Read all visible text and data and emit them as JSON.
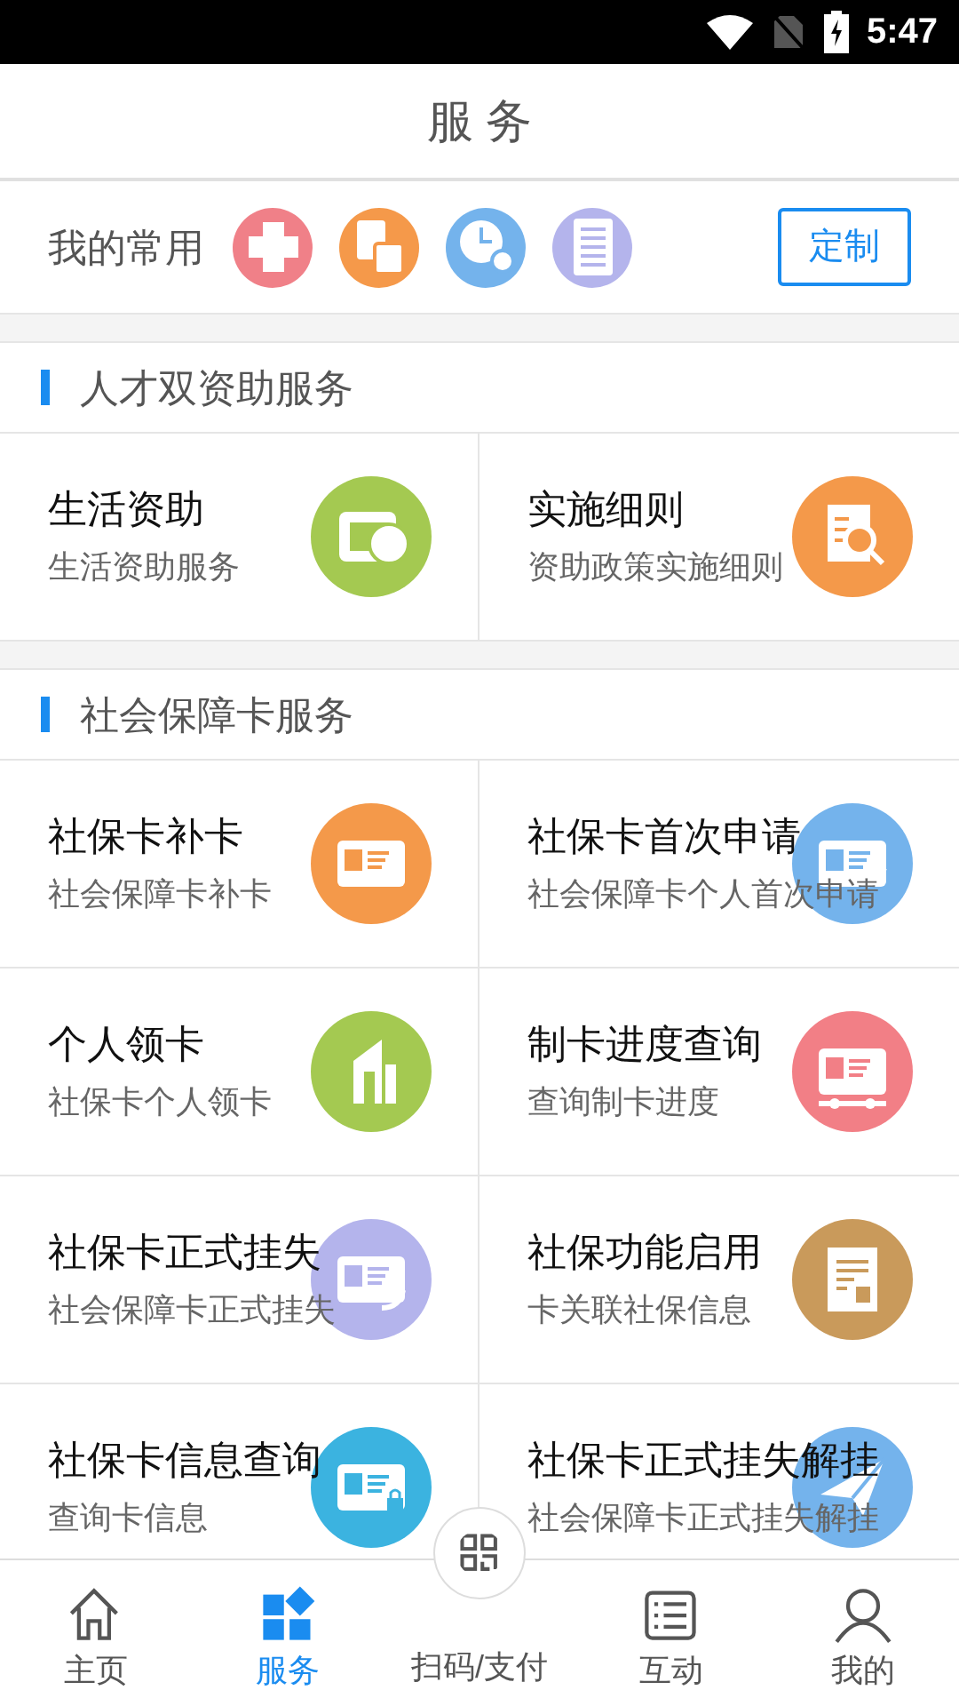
{
  "status_bar": {
    "time": "5:47"
  },
  "header": {
    "title": "服 务"
  },
  "favorites": {
    "label": "我的常用",
    "items": [
      {
        "color": "#f08088"
      },
      {
        "color": "#f5994a"
      },
      {
        "color": "#74b3ec"
      },
      {
        "color": "#b4b4ec"
      }
    ],
    "customize_button": "定制"
  },
  "sections": [
    {
      "title": "人才双资助服务",
      "items": [
        {
          "title": "生活资助",
          "subtitle": "生活资助服务",
          "color": "#a4c951"
        },
        {
          "title": "实施细则",
          "subtitle": "资助政策实施细则",
          "color": "#f4994a"
        }
      ]
    },
    {
      "title": "社会保障卡服务",
      "items": [
        {
          "title": "社保卡补卡",
          "subtitle": "社会保障卡补卡",
          "color": "#f4994a"
        },
        {
          "title": "社保卡首次申请",
          "subtitle": "社会保障卡个人首次申请",
          "color": "#74b3ec"
        },
        {
          "title": "个人领卡",
          "subtitle": "社保卡个人领卡",
          "color": "#a4c951"
        },
        {
          "title": "制卡进度查询",
          "subtitle": "查询制卡进度",
          "color": "#f27f86"
        },
        {
          "title": "社保卡正式挂失",
          "subtitle": "社会保障卡正式挂失",
          "color": "#b4b4ec"
        },
        {
          "title": "社保功能启用",
          "subtitle": "卡关联社保信息",
          "color": "#c99a5b"
        },
        {
          "title": "社保卡信息查询",
          "subtitle": "查询卡信息",
          "color": "#3bb3e0"
        },
        {
          "title": "社保卡正式挂失解挂",
          "subtitle": "社会保障卡正式挂失解挂",
          "color": "#74b3ec"
        }
      ]
    }
  ],
  "bottom_nav": [
    {
      "kind": "tab",
      "label": "主页",
      "selected": false
    },
    {
      "kind": "tab",
      "label": "服务",
      "selected": true
    },
    {
      "kind": "scan",
      "label": "扫码/支付",
      "selected": false
    },
    {
      "kind": "tab",
      "label": "互动",
      "selected": false
    },
    {
      "kind": "tab",
      "label": "我的",
      "selected": false
    }
  ]
}
